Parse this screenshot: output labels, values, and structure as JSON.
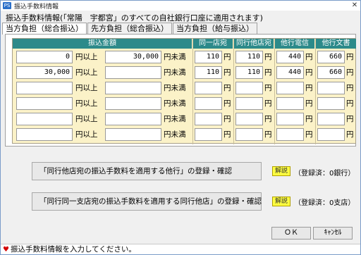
{
  "window": {
    "title": "振込手数料情報",
    "app_icon": "PS",
    "close_glyph": "✕"
  },
  "subtitle": "振込手数料情報(「常陽　宇都宮」のすべての自社銀行口座に適用されます)",
  "tabs": [
    {
      "label": "当方負担（総合振込）",
      "active": true
    },
    {
      "label": "先方負担（総合振込）",
      "active": false
    },
    {
      "label": "当方負担（給与振込）",
      "active": false
    }
  ],
  "grid": {
    "headers": {
      "amount": "振込金額",
      "same_branch": "同一店宛",
      "same_bank_other": "同行他店宛",
      "other_elec": "他行電信",
      "other_doc": "他行文書"
    },
    "from_label": "円以上",
    "to_label": "円未満",
    "yen": "円",
    "rows": [
      {
        "from": "0",
        "to": "30,000",
        "same_branch": "110",
        "same_bank_other": "110",
        "other_elec": "440",
        "other_doc": "660"
      },
      {
        "from": "30,000",
        "to": "",
        "same_branch": "110",
        "same_bank_other": "110",
        "other_elec": "440",
        "other_doc": "660"
      },
      {
        "from": "",
        "to": "",
        "same_branch": "",
        "same_bank_other": "",
        "other_elec": "",
        "other_doc": ""
      },
      {
        "from": "",
        "to": "",
        "same_branch": "",
        "same_bank_other": "",
        "other_elec": "",
        "other_doc": ""
      },
      {
        "from": "",
        "to": "",
        "same_branch": "",
        "same_bank_other": "",
        "other_elec": "",
        "other_doc": ""
      },
      {
        "from": "",
        "to": "",
        "same_branch": "",
        "same_bank_other": "",
        "other_elec": "",
        "other_doc": ""
      }
    ]
  },
  "registration": {
    "other_bank_button": "「同行他店宛の振込手数料を適用する他行」の登録・確認",
    "other_bank_help": "解説",
    "other_bank_status": "（登録済：0銀行）",
    "same_bank_button": "「同行同一支店宛の振込手数料を適用する同行他店」の登録・確認",
    "same_bank_help": "解説",
    "same_bank_status": "（登録済：0支店）"
  },
  "buttons": {
    "ok": "ＯＫ",
    "cancel": "ｷｬﾝｾﾙ"
  },
  "status_bar": {
    "icon": "heart-icon",
    "text": "振込手数料情報を入力してください。"
  },
  "colors": {
    "header": "#2c8a8a",
    "grid_bg": "#fbf2c8",
    "help_bg": "#ffff40",
    "status_heart": "#d40000"
  }
}
